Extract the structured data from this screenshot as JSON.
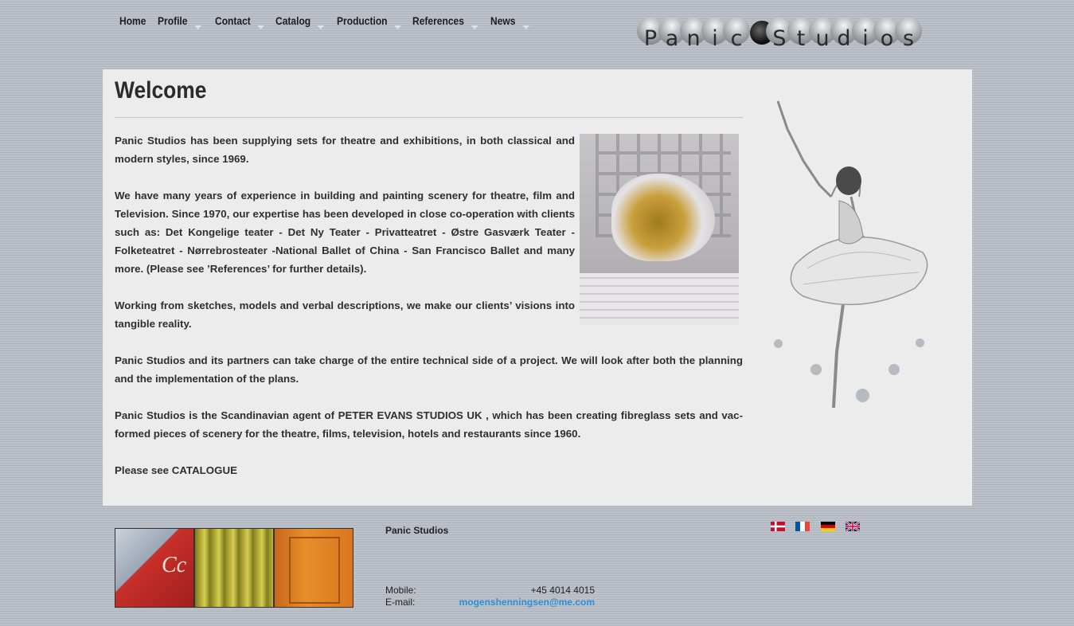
{
  "nav": {
    "items": [
      {
        "label": "Home",
        "has_submenu": false
      },
      {
        "label": "Profile",
        "has_submenu": true
      },
      {
        "label": "Contact",
        "has_submenu": true
      },
      {
        "label": "Catalog",
        "has_submenu": true
      },
      {
        "label": "Production",
        "has_submenu": true
      },
      {
        "label": "References",
        "has_submenu": true
      },
      {
        "label": "News",
        "has_submenu": true
      }
    ]
  },
  "logo": {
    "letters": [
      "P",
      "a",
      "n",
      "i",
      "c",
      "",
      "S",
      "t",
      "u",
      "d",
      "i",
      "o",
      "s"
    ],
    "alt": "Panic Studios"
  },
  "main": {
    "title": "Welcome",
    "paragraphs": [
      "Panic Studios has been supplying sets for theatre and exhibitions, in both classical and modern styles, since 1969.",
      "We have many years of experience in building and painting scenery for theatre, film and Television. Since 1970, our expertise has been developed in close co-operation with clients such as: Det Kongelige teater - Det Ny Teater - Privatteatret - Østre Gasværk Teater - Folketeatret - Nørrebrosteater -National Ballet of China - San Francisco Ballet and many more. (Please see ’References’ for further details).",
      "Working from sketches, models and verbal descriptions, we make our clients’ visions into tangible reality.",
      "Panic Studios and its partners can take charge of the entire technical side of a project. We will look after both the planning and the implementation of the plans.",
      "Panic Studios is the Scandinavian agent of PETER EVANS STUDIOS UK , which has been creating fibreglass sets and vac-formed pieces of scenery for the theatre, films, television, hotels and restaurants since 1960.",
      "Please see CATALOGUE"
    ]
  },
  "footer": {
    "company": "Panic Studios",
    "mobile_label": "Mobile:",
    "mobile_value": "+45  4014 4015",
    "email_label": "E-mail:",
    "email_value": "mogenshenningsen@me.com"
  },
  "flags": [
    {
      "name": "flag-denmark-icon",
      "title": "Danish"
    },
    {
      "name": "flag-france-icon",
      "title": "French"
    },
    {
      "name": "flag-germany-icon",
      "title": "German"
    },
    {
      "name": "flag-uk-icon",
      "title": "English"
    }
  ],
  "colors": {
    "link": "#2c8fd8",
    "panel": "#ececec",
    "text": "#2f2f2f"
  }
}
